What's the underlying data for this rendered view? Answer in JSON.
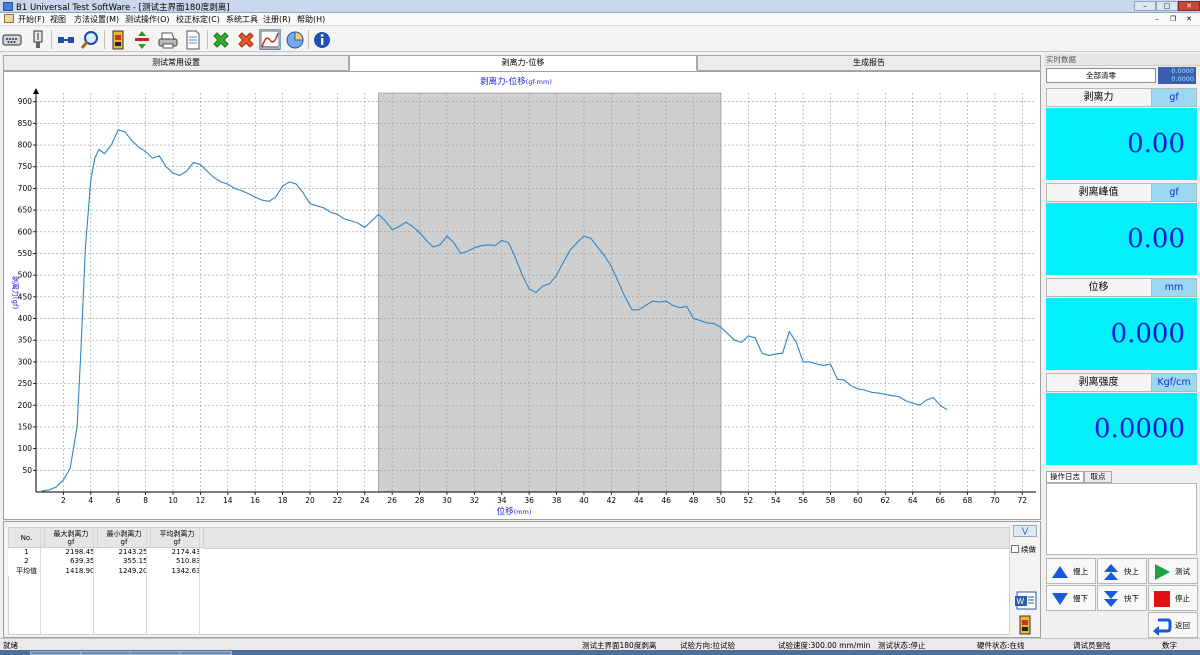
{
  "window": {
    "title": "B1 Universal Test SoftWare - [测试主界面180度剥离]"
  },
  "menu": [
    {
      "label": "开始(F)"
    },
    {
      "label": "视图"
    },
    {
      "label": "方法设置(M)"
    },
    {
      "label": "测试操作(O)"
    },
    {
      "label": "校正标定(C)"
    },
    {
      "label": "系统工具"
    },
    {
      "label": "注册(R)"
    },
    {
      "label": "帮助(H)"
    }
  ],
  "toolbar": [
    {
      "icon": "serial-port-icon"
    },
    {
      "icon": "sensor-icon"
    },
    {
      "icon": "connect-icon"
    },
    {
      "icon": "search-icon"
    },
    {
      "icon": "load-cell-icon"
    },
    {
      "icon": "limit-icon"
    },
    {
      "icon": "printer-icon"
    },
    {
      "icon": "document-icon"
    },
    {
      "icon": "green-cross-icon"
    },
    {
      "icon": "red-cross-icon"
    },
    {
      "icon": "curve-icon"
    },
    {
      "icon": "pie-chart-icon"
    },
    {
      "icon": "info-icon"
    }
  ],
  "tabs": [
    {
      "label": "测试常用设置"
    },
    {
      "label": "剥离力-位移"
    },
    {
      "label": "生成报告"
    }
  ],
  "chart_data": {
    "type": "line",
    "title": "剥离力-位移",
    "title_unit": "(gf-mm)",
    "xlabel": "位移",
    "xlabel_unit": "(mm)",
    "ylabel": "剥离力(gf)",
    "xlim": [
      0,
      73
    ],
    "ylim": [
      0,
      920
    ],
    "x_ticks": [
      2,
      4,
      6,
      8,
      10,
      12,
      14,
      16,
      18,
      20,
      22,
      24,
      26,
      28,
      30,
      32,
      34,
      36,
      38,
      40,
      42,
      44,
      46,
      48,
      50,
      52,
      54,
      56,
      58,
      60,
      62,
      64,
      66,
      68,
      70,
      72
    ],
    "y_ticks": [
      50,
      100,
      150,
      200,
      250,
      300,
      350,
      400,
      450,
      500,
      550,
      600,
      650,
      700,
      750,
      800,
      850,
      900
    ],
    "grid": true,
    "shaded_region": [
      25,
      50
    ],
    "line_color": "#2f86c8",
    "shade_color": "#cfcfcf",
    "x": [
      0.4,
      1.0,
      1.5,
      2.0,
      2.5,
      3.0,
      3.3,
      3.6,
      4.0,
      4.3,
      4.6,
      5.0,
      5.5,
      6.0,
      6.5,
      7.0,
      7.5,
      8.0,
      8.5,
      9.0,
      9.5,
      10.0,
      10.5,
      11.0,
      11.5,
      12.0,
      12.5,
      13.0,
      13.5,
      14.0,
      14.5,
      15.0,
      15.5,
      16.0,
      16.5,
      17.0,
      17.5,
      18.0,
      18.5,
      19.0,
      19.5,
      20.0,
      20.5,
      21.0,
      21.5,
      22.0,
      22.5,
      23.0,
      23.5,
      24.0,
      24.5,
      25.0,
      25.5,
      26.0,
      26.5,
      27.0,
      27.5,
      28.0,
      28.5,
      29.0,
      29.5,
      30.0,
      30.5,
      31.0,
      31.5,
      32.0,
      32.5,
      33.0,
      33.5,
      34.0,
      34.5,
      35.0,
      35.5,
      36.0,
      36.5,
      37.0,
      37.5,
      38.0,
      38.5,
      39.0,
      39.5,
      40.0,
      40.5,
      41.0,
      41.5,
      42.0,
      42.5,
      43.0,
      43.5,
      44.0,
      44.5,
      45.0,
      45.5,
      46.0,
      46.5,
      47.0,
      47.5,
      48.0,
      48.5,
      49.0,
      49.5,
      50.0,
      50.5,
      51.0,
      51.5,
      52.0,
      52.5,
      53.0,
      53.5,
      54.0,
      54.5,
      55.0,
      55.5,
      56.0,
      56.5,
      57.0,
      57.5,
      58.0,
      58.5,
      59.0,
      59.5,
      60.0,
      60.5,
      61.0,
      61.5,
      62.0,
      62.5,
      63.0,
      63.5,
      64.0,
      64.5,
      65.0,
      65.5,
      66.0,
      66.5
    ],
    "series": [
      {
        "values": [
          2,
          5,
          12,
          28,
          55,
          150,
          340,
          560,
          720,
          770,
          790,
          780,
          800,
          835,
          830,
          810,
          795,
          785,
          770,
          775,
          750,
          735,
          730,
          740,
          760,
          755,
          740,
          725,
          715,
          710,
          700,
          695,
          688,
          680,
          673,
          670,
          680,
          705,
          715,
          710,
          690,
          665,
          660,
          655,
          645,
          640,
          630,
          625,
          620,
          610,
          625,
          640,
          625,
          605,
          612,
          622,
          612,
          598,
          580,
          565,
          570,
          590,
          575,
          550,
          555,
          563,
          568,
          570,
          568,
          580,
          575,
          540,
          500,
          468,
          460,
          475,
          480,
          500,
          530,
          558,
          575,
          590,
          585,
          565,
          545,
          520,
          485,
          450,
          420,
          420,
          430,
          440,
          438,
          440,
          430,
          425,
          428,
          400,
          395,
          390,
          388,
          380,
          365,
          350,
          345,
          360,
          355,
          320,
          315,
          318,
          320,
          370,
          345,
          300,
          300,
          295,
          292,
          295,
          260,
          258,
          245,
          238,
          235,
          230,
          228,
          225,
          222,
          220,
          210,
          205,
          200,
          212,
          218,
          200,
          190,
          185,
          185
        ]
      }
    ],
    "summary_table": {
      "headers": [
        [
          "No.",
          ""
        ],
        [
          "最大剥离力",
          "gf"
        ],
        [
          "最小剥离力",
          "gf"
        ],
        [
          "平均剥离力",
          "gf"
        ]
      ],
      "rows": [
        [
          "1",
          "2198.45",
          "2143.25",
          "2174.43"
        ],
        [
          "2",
          "639.35",
          "355.15",
          "510.83"
        ],
        [
          "平均值",
          "1418.90",
          "1249.20",
          "1342.63"
        ]
      ]
    }
  },
  "realtime": {
    "title": "实时数据",
    "clear_button": "全部清零",
    "small_values": [
      "0.0000",
      "0.0000"
    ],
    "meters": [
      {
        "label": "剥离力",
        "unit": "gf",
        "value": "0.00"
      },
      {
        "label": "剥离峰值",
        "unit": "gf",
        "value": "0.00"
      },
      {
        "label": "位移",
        "unit": "mm",
        "value": "0.000"
      },
      {
        "label": "剥离强度",
        "unit": "Kgf/cm",
        "value": "0.0000"
      }
    ]
  },
  "log": {
    "tabs": [
      {
        "label": "操作日志"
      },
      {
        "label": "取点"
      }
    ]
  },
  "controls": {
    "slow_up": "慢上",
    "fast_up": "快上",
    "test": "测试",
    "slow_down": "慢下",
    "fast_down": "快下",
    "stop": "停止",
    "return": "返回"
  },
  "continue_checkbox": "续做",
  "status": {
    "ready": "就绪",
    "screen": "测试主界面180度剥离",
    "direction": "试验方向:拉试验",
    "speed": "试验速度:300.00 mm/min",
    "test_state": "测试状态:停止",
    "hw_state": "硬件状态:在线",
    "user": "调试员登陆",
    "mode": "数字"
  },
  "colors": {
    "meter_bg": "#02f0fb",
    "meter_text": "#1a1ad6",
    "unit_bg": "#9bd8f2"
  }
}
